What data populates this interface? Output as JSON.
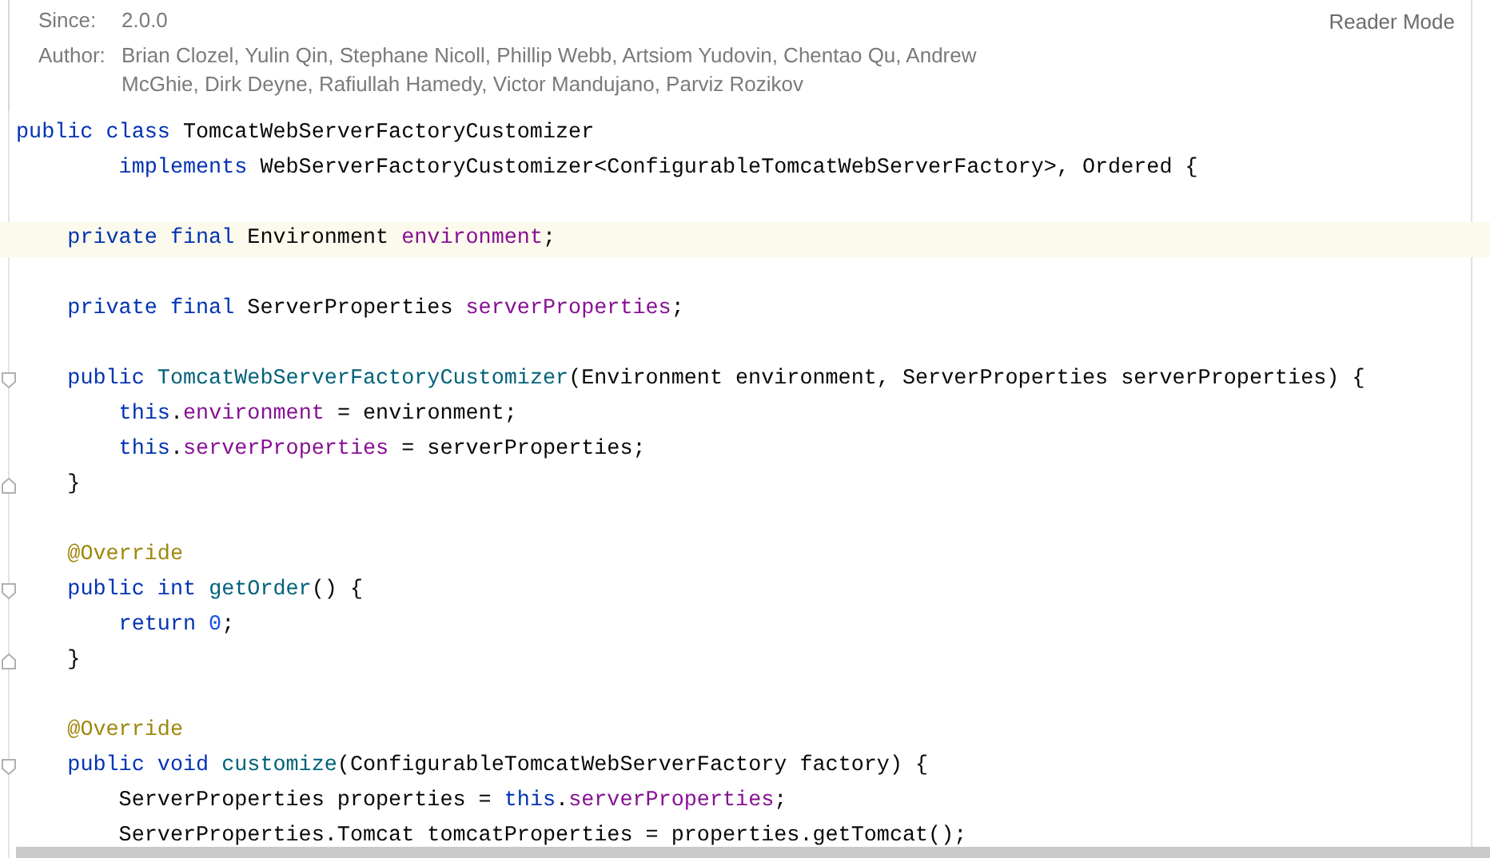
{
  "doc": {
    "fields": [
      {
        "label": "Since:",
        "value": "2.0.0"
      },
      {
        "label": "Author:",
        "value": "Brian Clozel, Yulin Qin, Stephane Nicoll, Phillip Webb, Artsiom Yudovin, Chentao Qu, Andrew McGhie, Dirk Deyne, Rafiullah Hamedy, Victor Mandujano, Parviz Rozikov"
      }
    ],
    "reader_mode": "Reader Mode"
  },
  "code": [
    {
      "kind": "code",
      "current": false,
      "tokens": [
        {
          "kind": "keyword",
          "text": "public class "
        },
        {
          "kind": "plain",
          "text": "TomcatWebServerFactoryCustomizer"
        }
      ]
    },
    {
      "kind": "code",
      "current": false,
      "tokens": [
        {
          "kind": "keyword",
          "text": "        implements "
        },
        {
          "kind": "plain",
          "text": "WebServerFactoryCustomizer<ConfigurableTomcatWebServerFactory>, Ordered {"
        }
      ]
    },
    {
      "kind": "blank"
    },
    {
      "kind": "code",
      "current": true,
      "tokens": [
        {
          "kind": "keyword",
          "text": "    private final "
        },
        {
          "kind": "plain",
          "text": "Environment "
        },
        {
          "kind": "field",
          "text": "environment"
        },
        {
          "kind": "plain",
          "text": ";"
        }
      ]
    },
    {
      "kind": "blank"
    },
    {
      "kind": "code",
      "current": false,
      "tokens": [
        {
          "kind": "keyword",
          "text": "    private final "
        },
        {
          "kind": "plain",
          "text": "ServerProperties "
        },
        {
          "kind": "field",
          "text": "serverProperties"
        },
        {
          "kind": "plain",
          "text": ";"
        }
      ]
    },
    {
      "kind": "blank"
    },
    {
      "kind": "code",
      "current": false,
      "fold_start": true,
      "tokens": [
        {
          "kind": "keyword",
          "text": "    public "
        },
        {
          "kind": "method",
          "text": "TomcatWebServerFactoryCustomizer"
        },
        {
          "kind": "plain",
          "text": "(Environment environment, ServerProperties serverProperties) {"
        }
      ]
    },
    {
      "kind": "code",
      "current": false,
      "tokens": [
        {
          "kind": "keyword",
          "text": "        this"
        },
        {
          "kind": "plain",
          "text": "."
        },
        {
          "kind": "field",
          "text": "environment"
        },
        {
          "kind": "plain",
          "text": " = environment;"
        }
      ]
    },
    {
      "kind": "code",
      "current": false,
      "tokens": [
        {
          "kind": "keyword",
          "text": "        this"
        },
        {
          "kind": "plain",
          "text": "."
        },
        {
          "kind": "field",
          "text": "serverProperties"
        },
        {
          "kind": "plain",
          "text": " = serverProperties;"
        }
      ]
    },
    {
      "kind": "code",
      "current": false,
      "fold_end": true,
      "tokens": [
        {
          "kind": "plain",
          "text": "    }"
        }
      ]
    },
    {
      "kind": "blank"
    },
    {
      "kind": "code",
      "current": false,
      "tokens": [
        {
          "kind": "annotation",
          "text": "    @Override"
        }
      ]
    },
    {
      "kind": "code",
      "current": false,
      "fold_start": true,
      "tokens": [
        {
          "kind": "keyword",
          "text": "    public int "
        },
        {
          "kind": "method",
          "text": "getOrder"
        },
        {
          "kind": "plain",
          "text": "() {"
        }
      ]
    },
    {
      "kind": "code",
      "current": false,
      "tokens": [
        {
          "kind": "keyword",
          "text": "        return "
        },
        {
          "kind": "number",
          "text": "0"
        },
        {
          "kind": "plain",
          "text": ";"
        }
      ]
    },
    {
      "kind": "code",
      "current": false,
      "fold_end": true,
      "tokens": [
        {
          "kind": "plain",
          "text": "    }"
        }
      ]
    },
    {
      "kind": "blank"
    },
    {
      "kind": "code",
      "current": false,
      "tokens": [
        {
          "kind": "annotation",
          "text": "    @Override"
        }
      ]
    },
    {
      "kind": "code",
      "current": false,
      "fold_start": true,
      "tokens": [
        {
          "kind": "keyword",
          "text": "    public void "
        },
        {
          "kind": "method",
          "text": "customize"
        },
        {
          "kind": "plain",
          "text": "(ConfigurableTomcatWebServerFactory factory) {"
        }
      ]
    },
    {
      "kind": "code",
      "current": false,
      "tokens": [
        {
          "kind": "plain",
          "text": "        ServerProperties properties = "
        },
        {
          "kind": "keyword",
          "text": "this"
        },
        {
          "kind": "plain",
          "text": "."
        },
        {
          "kind": "field",
          "text": "serverProperties"
        },
        {
          "kind": "plain",
          "text": ";"
        }
      ]
    },
    {
      "kind": "code",
      "current": false,
      "tokens": [
        {
          "kind": "plain",
          "text": "        ServerProperties.Tomcat tomcatProperties = properties.getTomcat();"
        }
      ]
    }
  ]
}
